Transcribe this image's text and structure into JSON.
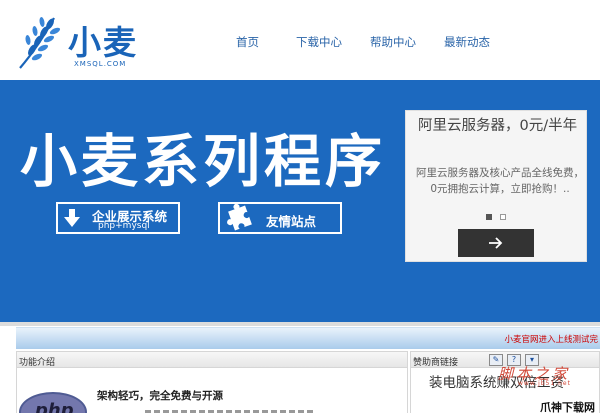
{
  "header": {
    "logo_text": "小麦",
    "logo_domain": "XMSQL.COM",
    "nav": [
      {
        "label": "首页"
      },
      {
        "label": "下载中心"
      },
      {
        "label": "帮助中心"
      },
      {
        "label": "最新动态"
      }
    ]
  },
  "banner": {
    "title": "小麦系列程序",
    "button_enterprise": {
      "label": "企业展示系统",
      "sub": "php+mysql",
      "icon": "download-arrow-icon"
    },
    "button_links": {
      "label": "友情站点",
      "icon": "puzzle-icon"
    }
  },
  "ad": {
    "title": "阿里云服务器，0元/半年",
    "description": "阿里云服务器及核心产品全线免费， 0元拥抱云计算，立即抢购！..",
    "slides": 2,
    "active_slide": 1
  },
  "marquee": {
    "text": "小麦官网进入上线测试完"
  },
  "features_panel": {
    "title": "功能介绍",
    "heading": "架构轻巧，完全免费与开源",
    "logo_text": "php"
  },
  "sponsor_panel": {
    "title": "赞助商链接",
    "ad_text": "装电脑系统赚双倍工资"
  },
  "watermarks": {
    "jiaoben": "脚本之家",
    "jiaoben_url": "www.jb51.net",
    "xzz": "爪神下载网"
  },
  "colors": {
    "brand_blue": "#1c69bf",
    "nav_text": "#2a64a8",
    "marquee_red": "#cc0000"
  }
}
